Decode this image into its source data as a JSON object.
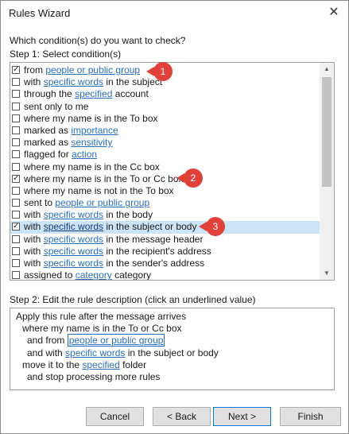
{
  "window": {
    "title": "Rules Wizard",
    "close_icon": "close-icon"
  },
  "prompt": "Which condition(s) do you want to check?",
  "step1_label": "Step 1: Select condition(s)",
  "conditions": [
    {
      "checked": true,
      "parts": [
        [
          "from ",
          false
        ],
        [
          "people or public group",
          true
        ]
      ]
    },
    {
      "checked": false,
      "parts": [
        [
          "with ",
          false
        ],
        [
          "specific words",
          true
        ],
        [
          " in the subject",
          false
        ]
      ]
    },
    {
      "checked": false,
      "parts": [
        [
          "through the ",
          false
        ],
        [
          "specified",
          true
        ],
        [
          " account",
          false
        ]
      ]
    },
    {
      "checked": false,
      "parts": [
        [
          "sent only to me",
          false
        ]
      ]
    },
    {
      "checked": false,
      "parts": [
        [
          "where my name is in the To box",
          false
        ]
      ]
    },
    {
      "checked": false,
      "parts": [
        [
          "marked as ",
          false
        ],
        [
          "importance",
          true
        ]
      ]
    },
    {
      "checked": false,
      "parts": [
        [
          "marked as ",
          false
        ],
        [
          "sensitivity",
          true
        ]
      ]
    },
    {
      "checked": false,
      "parts": [
        [
          "flagged for ",
          false
        ],
        [
          "action",
          true
        ]
      ]
    },
    {
      "checked": false,
      "parts": [
        [
          "where my name is in the Cc box",
          false
        ]
      ]
    },
    {
      "checked": true,
      "parts": [
        [
          "where my name is in the To or Cc box",
          false
        ]
      ]
    },
    {
      "checked": false,
      "parts": [
        [
          "where my name is not in the To box",
          false
        ]
      ]
    },
    {
      "checked": false,
      "parts": [
        [
          "sent to ",
          false
        ],
        [
          "people or public group",
          true
        ]
      ]
    },
    {
      "checked": false,
      "parts": [
        [
          "with ",
          false
        ],
        [
          "specific words",
          true
        ],
        [
          " in the body",
          false
        ]
      ]
    },
    {
      "checked": true,
      "selected": true,
      "parts": [
        [
          "with ",
          false
        ],
        [
          "specific words",
          true
        ],
        [
          " in the subject or body",
          false
        ]
      ]
    },
    {
      "checked": false,
      "parts": [
        [
          "with ",
          false
        ],
        [
          "specific words",
          true
        ],
        [
          " in the message header",
          false
        ]
      ]
    },
    {
      "checked": false,
      "parts": [
        [
          "with ",
          false
        ],
        [
          "specific words",
          true
        ],
        [
          " in the recipient's address",
          false
        ]
      ]
    },
    {
      "checked": false,
      "parts": [
        [
          "with ",
          false
        ],
        [
          "specific words",
          true
        ],
        [
          " in the sender's address",
          false
        ]
      ]
    },
    {
      "checked": false,
      "parts": [
        [
          "assigned to ",
          false
        ],
        [
          "category",
          true
        ],
        [
          " category",
          false
        ]
      ]
    }
  ],
  "badges": [
    "1",
    "2",
    "3"
  ],
  "step2_label": "Step 2: Edit the rule description (click an underlined value)",
  "description": [
    {
      "indent": 1,
      "parts": [
        [
          "Apply this rule after the message arrives",
          false
        ]
      ]
    },
    {
      "indent": 2,
      "parts": [
        [
          "where my name is in the To or Cc box",
          false
        ]
      ]
    },
    {
      "indent": 3,
      "parts": [
        [
          "and from ",
          false
        ],
        [
          "people or public group",
          "boxed"
        ]
      ]
    },
    {
      "indent": 3,
      "parts": [
        [
          "and with ",
          false
        ],
        [
          "specific words",
          true
        ],
        [
          " in the subject or body",
          false
        ]
      ]
    },
    {
      "indent": 2,
      "parts": [
        [
          "move it to the ",
          false
        ],
        [
          "specified",
          true
        ],
        [
          " folder",
          false
        ]
      ]
    },
    {
      "indent": 3,
      "parts": [
        [
          "and stop processing more rules",
          false
        ]
      ]
    }
  ],
  "buttons": {
    "cancel": "Cancel",
    "back": "< Back",
    "next": "Next >",
    "finish": "Finish"
  },
  "colors": {
    "link": "#2a6fbe",
    "selection": "#cce4f7",
    "badge": "#e0413a",
    "default_button_border": "#0078d7"
  }
}
